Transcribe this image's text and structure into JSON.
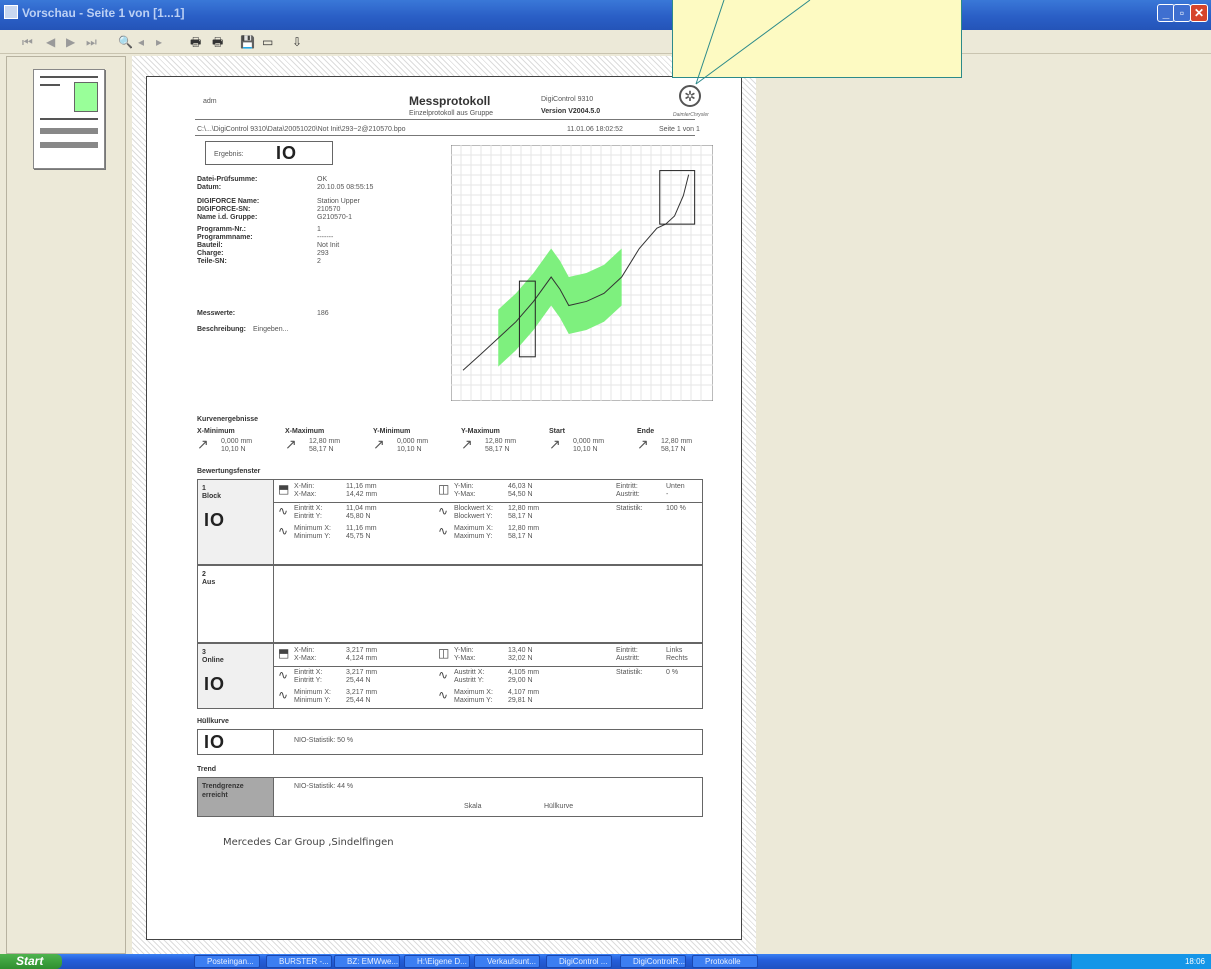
{
  "window": {
    "title": "Vorschau - Seite 1 von [1...1]"
  },
  "toolbar": {
    "buttons": [
      "⏮",
      "◀",
      "▶",
      "⏭",
      "🔍",
      "◂",
      "▸",
      "🖶",
      "🖶",
      "💾",
      "▭",
      "⇩"
    ]
  },
  "report": {
    "user": "adm",
    "title": "Messprotokoll",
    "subtitle": "Einzelprotokoll aus Gruppe",
    "product": "DigiControl 9310",
    "version": "Version V2004.5.0",
    "brand": "DaimlerChrysler",
    "path": "C:\\...\\DigiControl 9310\\Data\\20051020\\Not Init\\293~2@210570.bpo",
    "timestamp": "11.01.06 18:02:52",
    "page": "Seite 1 von 1",
    "result_label": "Ergebnis:",
    "result_value": "IO",
    "fields": [
      {
        "k": "Datei-Prüfsumme:",
        "v": "OK"
      },
      {
        "k": "Datum:",
        "v": "20.10.05 08:55:15"
      },
      {
        "k": "DIGIFORCE Name:",
        "v": "Station Upper"
      },
      {
        "k": "DIGIFORCE-SN:",
        "v": "210570"
      },
      {
        "k": "Name i.d. Gruppe:",
        "v": "G210570-1"
      },
      {
        "k": "Programm-Nr.:",
        "v": "1"
      },
      {
        "k": "Programmname:",
        "v": "-------"
      },
      {
        "k": "Bauteil:",
        "v": "Not Init"
      },
      {
        "k": "Charge:",
        "v": "293"
      },
      {
        "k": "Teile-SN:",
        "v": "2"
      }
    ],
    "messwerte_label": "Messwerte:",
    "messwerte_value": "186",
    "beschreibung_label": "Beschreibung:",
    "beschreibung_value": "Eingeben...",
    "kurven_title": "Kurvenergebnisse",
    "kurven": [
      {
        "label": "X-Minimum",
        "l1": "0,000 mm",
        "l2": "10,10 N"
      },
      {
        "label": "X-Maximum",
        "l1": "12,80 mm",
        "l2": "58,17 N"
      },
      {
        "label": "Y-Minimum",
        "l1": "0,000 mm",
        "l2": "10,10 N"
      },
      {
        "label": "Y-Maximum",
        "l1": "12,80 mm",
        "l2": "58,17 N"
      },
      {
        "label": "Start",
        "l1": "0,000 mm",
        "l2": "10,10 N"
      },
      {
        "label": "Ende",
        "l1": "12,80 mm",
        "l2": "58,17 N"
      }
    ],
    "bewertung_title": "Bewertungsfenster",
    "win1": {
      "num": "1",
      "name": "Block",
      "io": "IO",
      "r1": [
        "X-Min:",
        "11,16 mm",
        "X-Max:",
        "14,42 mm",
        "Y-Min:",
        "46,03 N",
        "Y-Max:",
        "54,50 N",
        "Eintritt:",
        "Unten",
        "Austritt:",
        "-"
      ],
      "r2": [
        "Eintritt X:",
        "11,04 mm",
        "Eintritt Y:",
        "45,80 N",
        "Blockwert X:",
        "12,80 mm",
        "Blockwert Y:",
        "58,17 N",
        "Statistik:",
        "100 %"
      ],
      "r3": [
        "Minimum X:",
        "11,16 mm",
        "Minimum Y:",
        "45,75 N",
        "Maximum X:",
        "12,80 mm",
        "Maximum Y:",
        "58,17 N"
      ]
    },
    "win2": {
      "num": "2",
      "name": "Aus"
    },
    "win3": {
      "num": "3",
      "name": "Online",
      "io": "IO",
      "r1": [
        "X-Min:",
        "3,217 mm",
        "X-Max:",
        "4,124 mm",
        "Y-Min:",
        "13,40 N",
        "Y-Max:",
        "32,02 N",
        "Eintritt:",
        "Links",
        "Austritt:",
        "Rechts"
      ],
      "r2": [
        "Eintritt X:",
        "3,217 mm",
        "Eintritt Y:",
        "25,44 N",
        "Austritt X:",
        "4,105 mm",
        "Austritt Y:",
        "29,00 N",
        "Statistik:",
        "0 %"
      ],
      "r3": [
        "Minimum X:",
        "3,217 mm",
        "Minimum Y:",
        "25,44 N",
        "Maximum X:",
        "4,107 mm",
        "Maximum Y:",
        "29,81 N"
      ]
    },
    "huell_title": "Hüllkurve",
    "huell_io": "IO",
    "huell_stat": "NIO-Statistik:  50 %",
    "trend_title": "Trend",
    "trend_label": "Trendgrenze erreicht",
    "trend_stat": "NIO-Statistik:  44 %",
    "trend_s1": "Skala",
    "trend_s2": "Hüllkurve",
    "footer": "Mercedes Car Group ,Sindelfingen"
  },
  "taskbar": {
    "start": "Start",
    "tasks": [
      "Posteingan...",
      "BURSTER -...",
      "BZ: EMWwe...",
      "H:\\Eigene D...",
      "Verkaufsunt...",
      "DigiControl ...",
      "DigiControlR...",
      "Protokolle"
    ],
    "clock": "18:06"
  },
  "chart_data": {
    "type": "line",
    "title": "",
    "xlabel": "",
    "ylabel": "",
    "series": [
      {
        "values": [
          [
            0,
            10.1
          ],
          [
            1,
            14
          ],
          [
            2,
            18
          ],
          [
            3,
            22
          ],
          [
            4,
            27
          ],
          [
            5,
            33
          ],
          [
            5.5,
            30
          ],
          [
            6,
            26
          ],
          [
            7,
            27
          ],
          [
            8,
            29
          ],
          [
            9,
            33
          ],
          [
            10,
            40
          ],
          [
            11,
            45
          ],
          [
            11.5,
            46
          ],
          [
            12,
            48
          ],
          [
            12.5,
            53
          ],
          [
            12.8,
            58.17
          ]
        ]
      }
    ],
    "windows_drawn": 3
  }
}
